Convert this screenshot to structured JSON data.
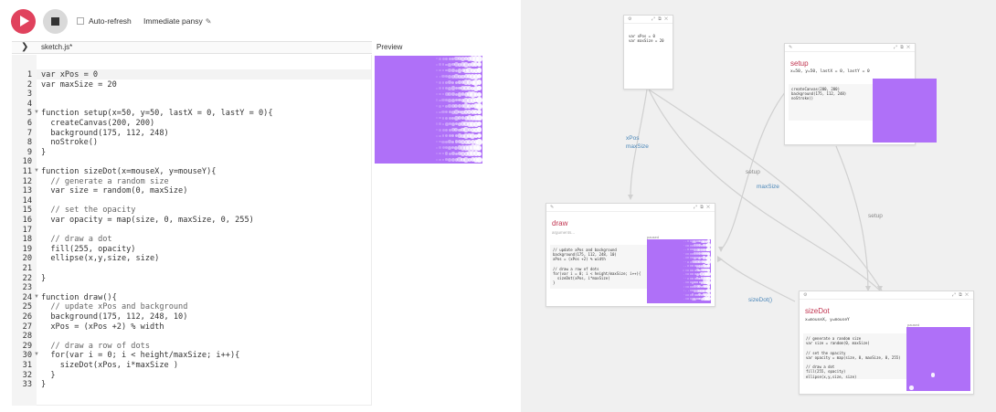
{
  "toolbar": {
    "auto_refresh_label": "Auto-refresh",
    "project_name": "Immediate pansy"
  },
  "editor": {
    "file_name": "sketch.js*",
    "preview_label": "Preview",
    "lines": [
      "var xPos = 0",
      "var maxSize = 20",
      "",
      "",
      "function setup(x=50, y=50, lastX = 0, lastY = 0){",
      "  createCanvas(200, 200)",
      "  background(175, 112, 248)",
      "  noStroke()",
      "}",
      "",
      "function sizeDot(x=mouseX, y=mouseY){",
      "  // generate a random size",
      "  var size = random(0, maxSize)",
      "",
      "  // set the opacity",
      "  var opacity = map(size, 0, maxSize, 0, 255)",
      "",
      "  // draw a dot",
      "  fill(255, opacity)",
      "  ellipse(x,y,size, size)",
      "",
      "}",
      "",
      "function draw(){",
      "  // update xPos and background",
      "  background(175, 112, 248, 10)",
      "  xPos = (xPos +2) % width",
      "",
      "  // draw a row of dots",
      "  for(var i = 0; i < height/maxSize; i++){",
      "    sizeDot(xPos, i*maxSize )",
      "  }",
      "}"
    ],
    "line_numbers": [
      "1",
      "2",
      "3",
      "4",
      "5",
      "6",
      "7",
      "8",
      "9",
      "10",
      "11",
      "12",
      "13",
      "14",
      "15",
      "16",
      "17",
      "18",
      "19",
      "20",
      "21",
      "22",
      "23",
      "24",
      "25",
      "26",
      "27",
      "28",
      "29",
      "30",
      "31",
      "32",
      "33"
    ]
  },
  "graph": {
    "vars_card": {
      "code": "var xPos = 0\nvar maxSize = 20"
    },
    "setup_card": {
      "title": "setup",
      "signature": "x=50, y=50, lastX = 0, lastY = 0",
      "code": "createCanvas(200, 200)\nbackground(175, 112, 248)\nnoStroke()"
    },
    "draw_card": {
      "title": "draw",
      "subtitle": "arguments...",
      "paused": "paused",
      "code": "// update xPos and background\nbackground(175, 112, 248, 10)\nxPos = (xPos +2) % width\n\n// draw a row of dots\nfor(var i = 0; i < height/maxSize; i++){\n  sizeDot(xPos, i*maxSize)\n}"
    },
    "sizedot_card": {
      "title": "sizeDot",
      "signature": "x=mouseX, y=mouseY",
      "paused": "paused",
      "code": "// generate a random size\nvar size = random(0, maxSize)\n\n// set the opacity\nvar opacity = map(size, 0, maxSize, 0, 255)\n\n// draw a dot\nfill(255, opacity)\nellipse(x,y,size, size)"
    },
    "edge_labels": {
      "xpos": "xPos",
      "maxsize1": "maxSize",
      "setup1": "setup",
      "maxsize2": "maxSize",
      "setup2": "setup",
      "sizedot": "sizeDot()"
    }
  },
  "colors": {
    "run": "#e0425d",
    "canvas": "#af70f8",
    "title": "#c0334f",
    "edge_label": "#4a86b8"
  },
  "icons": {
    "run": "play-icon",
    "stop": "stop-icon",
    "collapse": "chevron-right-icon",
    "edit": "pencil-icon"
  }
}
